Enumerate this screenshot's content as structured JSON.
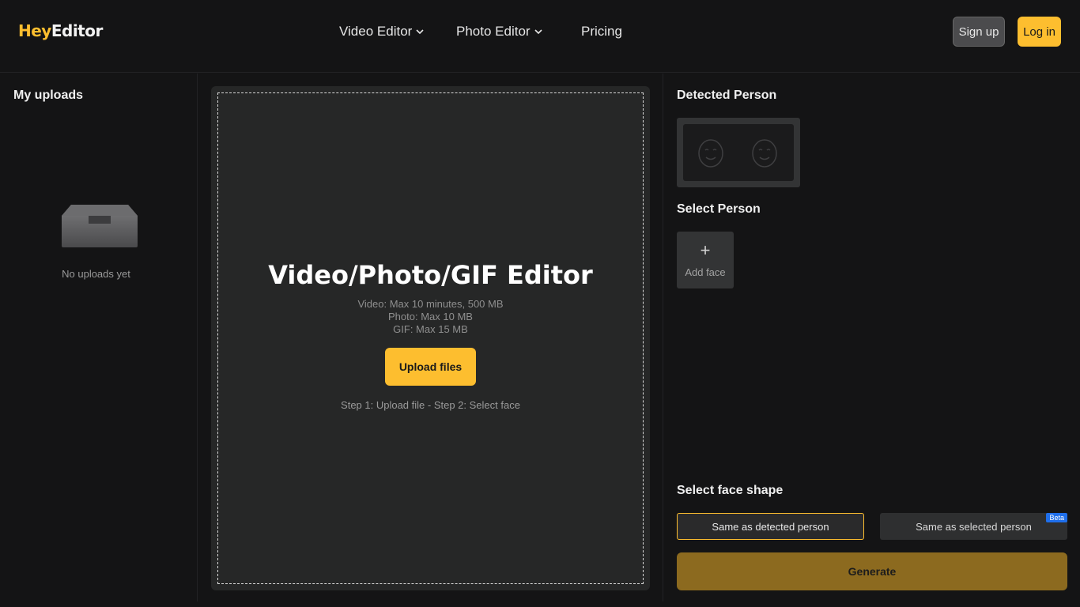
{
  "header": {
    "logo_part1": "Hey",
    "logo_part2": "Editor",
    "nav": [
      {
        "label": "Video Editor",
        "has_dropdown": true
      },
      {
        "label": "Photo Editor",
        "has_dropdown": true
      },
      {
        "label": "Pricing",
        "has_dropdown": false
      }
    ],
    "signup_label": "Sign up",
    "login_label": "Log in"
  },
  "sidebar": {
    "title": "My uploads",
    "empty_text": "No uploads yet",
    "empty_icon": "empty-tray-icon"
  },
  "upload": {
    "title": "Video/Photo/GIF Editor",
    "limits": [
      "Video: Max 10 minutes, 500 MB",
      "Photo: Max 10 MB",
      "GIF: Max 15 MB"
    ],
    "button_label": "Upload files",
    "steps": "Step 1: Upload file - Step 2: Select face"
  },
  "right": {
    "detected_title": "Detected Person",
    "select_title": "Select Person",
    "add_face_label": "Add face",
    "shape_title": "Select face shape",
    "shape_options": [
      "Same as detected person",
      "Same as selected person"
    ],
    "beta_label": "Beta",
    "generate_label": "Generate"
  },
  "colors": {
    "accent": "#fdbe2f",
    "background": "#141415",
    "panel": "#262727",
    "generate_disabled": "#8c6a1f",
    "beta": "#1f6feb"
  }
}
